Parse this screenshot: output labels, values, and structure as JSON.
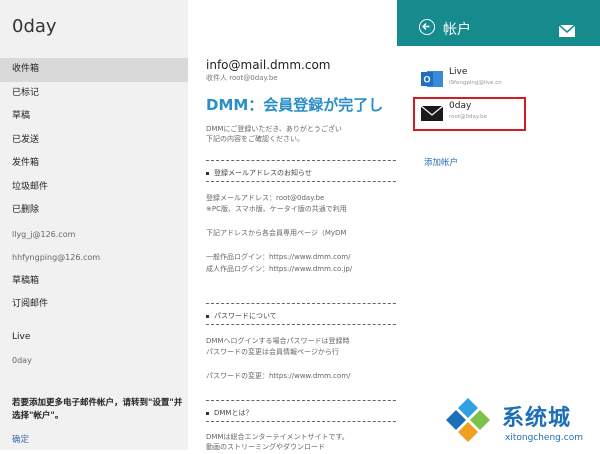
{
  "left_pane": {
    "account_title": "0day",
    "folders": [
      "收件箱",
      "已标记",
      "草稿",
      "已发送",
      "发件箱",
      "垃圾邮件",
      "已删除",
      "llyg_j@126.com",
      "hhfyngping@126.com",
      "草稿箱",
      "订阅邮件"
    ],
    "accounts": [
      "Live",
      "0day"
    ],
    "hint": "若要添加更多电子邮件帐户，请转到\"设置\"并选择\"帐户\"。",
    "confirm": "确定"
  },
  "reader": {
    "from": "info@mail.dmm.com",
    "sender": "收件人 root@0day.be",
    "subject": "DMM：会員登録が完了し",
    "intro": [
      "DMMにご登録いただき、ありがとうござい",
      "下記の内容をご確認ください。"
    ],
    "section1_title": "登録メールアドレスのお知らせ",
    "section1_lines": [
      "登録メールアドレス：root@0day.be",
      "※PC版、スマホ版、ケータイ版の共通で利用",
      "下記アドレスから各会員専用ページ（MyDM",
      "一般作品ログイン：https://www.dmm.com/",
      "成人作品ログイン：https://www.dmm.co.jp/"
    ],
    "section2_title": "パスワードについて",
    "section2_lines": [
      "DMMへログインする場合パスワードは登録時",
      "パスワードの変更は会員情報ページから行",
      "パスワードの変更：https://www.dmm.com/"
    ],
    "section3_title": "DMMとは？",
    "section3_lines": [
      "DMMは総合エンターテイメントサイトです。",
      "動画のストリーミングやダウンロード"
    ]
  },
  "flyout": {
    "title": "帐户",
    "accounts": [
      {
        "name": "Live",
        "email": "l9fengping@live.cn"
      },
      {
        "name": "0day",
        "email": "root@0day.be"
      }
    ],
    "add_account": "添加帐户"
  },
  "watermark": {
    "brand": "系统城",
    "url": "xitongcheng.com"
  },
  "colors": {
    "accent": "#158b8e",
    "link": "#2a6fb0",
    "highlight": "#d11b25",
    "outlook": "#1f6fc1"
  }
}
